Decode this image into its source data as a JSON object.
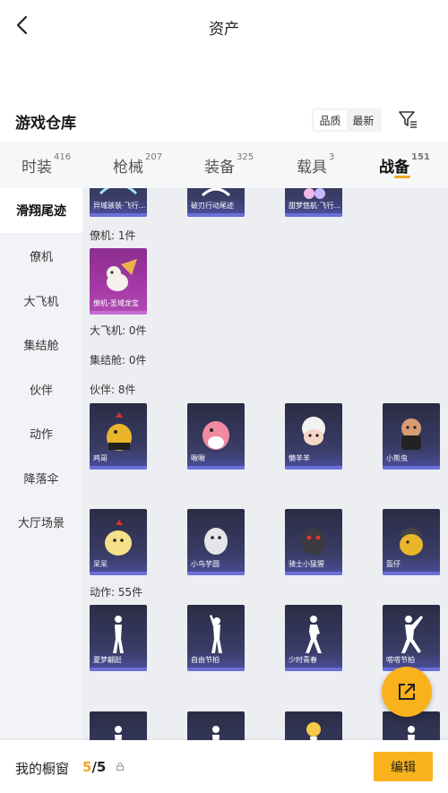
{
  "header": {
    "title": "资产"
  },
  "section": {
    "title": "游戏仓库"
  },
  "sort": {
    "quality": "品质",
    "newest": "最新"
  },
  "tabs": [
    {
      "label": "时装",
      "count": "416"
    },
    {
      "label": "枪械",
      "count": "207"
    },
    {
      "label": "装备",
      "count": "325"
    },
    {
      "label": "载具",
      "count": "3"
    },
    {
      "label": "战备",
      "count": "151"
    }
  ],
  "sidebar": [
    "滑翔尾迹",
    "僚机",
    "大飞机",
    "集结舱",
    "伙伴",
    "动作",
    "降落伞",
    "大厅场景"
  ],
  "groups": {
    "top_cards": [
      "异域骇装·飞行...",
      "破刃行动尾迹",
      "甜梦悠航·飞行..."
    ],
    "wingman_label": "僚机: 1件",
    "wingman_cards": [
      "僚机-圣域龙宝"
    ],
    "bigplane_label": "大飞机: 0件",
    "capsule_label": "集结舱: 0件",
    "partner_label": "伙伴: 8件",
    "partner_cards": [
      "鸡哥",
      "啾啾",
      "懒羊羊",
      "小熊虫",
      "呆呆",
      "小鸟芋圆",
      "骑士小猛猩",
      "盔仔"
    ],
    "action_label": "动作: 55件",
    "action_cards": [
      "夏梦翩跹",
      "自由节拍",
      "少时青春",
      "嗒嗒节拍"
    ]
  },
  "bottom": {
    "showcase": "我的橱窗",
    "current": "5",
    "total": "/5",
    "edit": "编辑"
  },
  "colors": {
    "accent": "#f9b21c",
    "card_dark": "#2a2c45",
    "card_purple": "#a53aa6"
  }
}
